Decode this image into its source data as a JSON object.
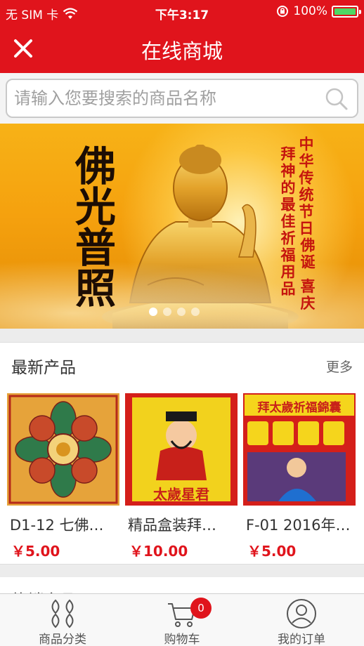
{
  "status_bar": {
    "carrier": "无 SIM 卡",
    "time": "下午3:17",
    "battery_text": "100%"
  },
  "header": {
    "title": "在线商城"
  },
  "search": {
    "placeholder": "请输入您要搜索的商品名称",
    "value": ""
  },
  "banner": {
    "calligraphy": "佛光普照",
    "vertical_lines": [
      "中华传统节日",
      "拜神的最佳祈福用品",
      "佛诞 喜庆"
    ],
    "slide_count": 4,
    "active_slide": 0
  },
  "latest": {
    "title": "最新产品",
    "more": "更多",
    "products": [
      {
        "name": "D1-12 七佛…",
        "price": "￥5.00",
        "thumb_text": ""
      },
      {
        "name": "精品盒装拜…",
        "price": "￥10.00",
        "thumb_text": "太歲星君"
      },
      {
        "name": "F-01 2016年…",
        "price": "￥5.00",
        "thumb_text": "拜太歲祈福錦囊"
      }
    ]
  },
  "next_section": {
    "title": "热销产品"
  },
  "tabbar": {
    "items": [
      {
        "label": "商品分类",
        "icon": "category-icon"
      },
      {
        "label": "购物车",
        "icon": "cart-icon",
        "badge": "0"
      },
      {
        "label": "我的订单",
        "icon": "user-icon"
      }
    ]
  },
  "colors": {
    "brand_red": "#e0141c",
    "banner_gold": "#f5a10e"
  }
}
